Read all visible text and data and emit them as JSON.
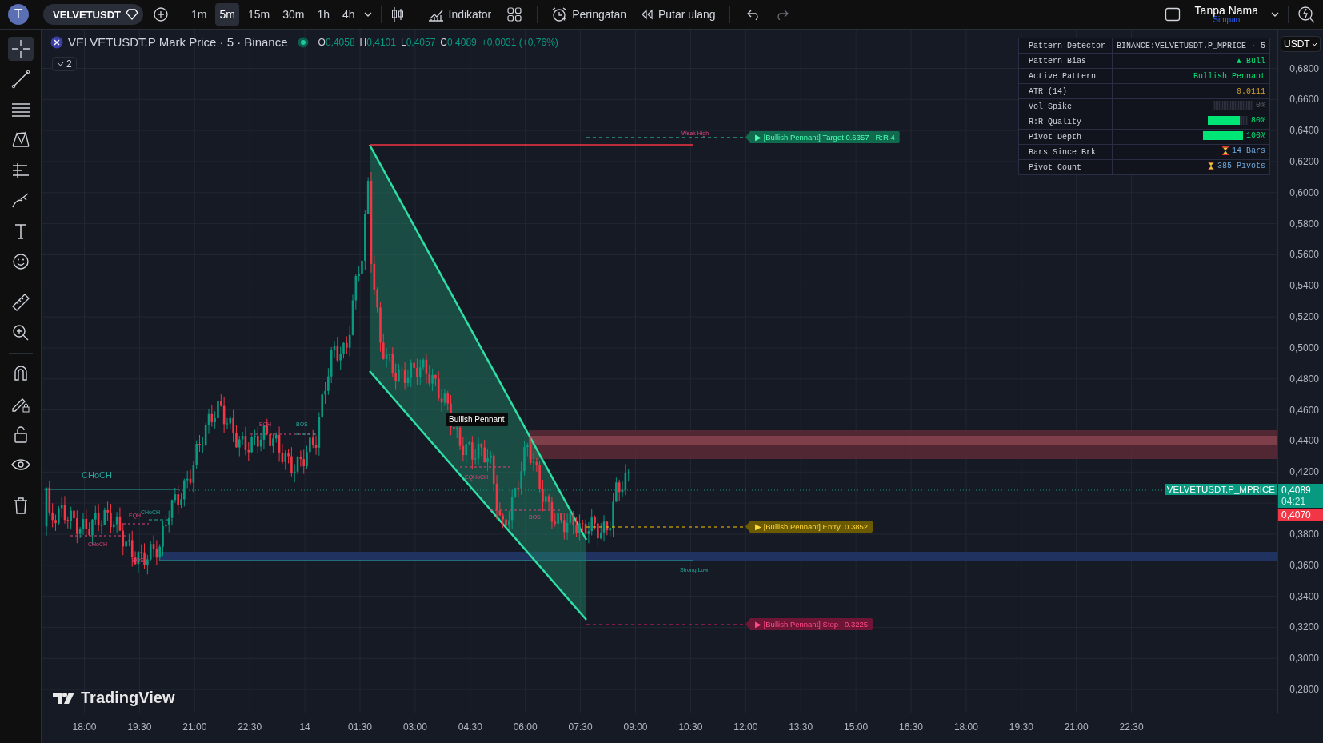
{
  "topbar": {
    "avatar": "T",
    "symbol": "VELVETUSDT",
    "intervals": [
      {
        "label": "1m",
        "selected": false
      },
      {
        "label": "5m",
        "selected": true
      },
      {
        "label": "15m",
        "selected": false
      },
      {
        "label": "30m",
        "selected": false
      },
      {
        "label": "1h",
        "selected": false
      },
      {
        "label": "4h",
        "selected": false
      }
    ],
    "actions": [
      {
        "kind": "indicators",
        "label": "Indikator"
      },
      {
        "kind": "alert",
        "label": "Peringatan"
      },
      {
        "kind": "replay",
        "label": "Putar ulang"
      }
    ],
    "layout_name": "Tanpa Nama",
    "save_status": "Simpan"
  },
  "tools": [
    {
      "kind": "crosshair",
      "selected": true
    },
    {
      "kind": "trend-line",
      "selected": false
    },
    {
      "kind": "fib",
      "selected": false
    },
    {
      "kind": "pattern",
      "selected": false
    },
    {
      "kind": "forecast",
      "selected": false
    },
    {
      "kind": "brush",
      "selected": false
    },
    {
      "kind": "text",
      "selected": false
    },
    {
      "kind": "emoji",
      "selected": false
    },
    {
      "kind": "ruler",
      "selected": false
    },
    {
      "kind": "zoom",
      "selected": false
    },
    {
      "kind": "magnet",
      "selected": false
    },
    {
      "kind": "lock-drawing",
      "selected": false
    },
    {
      "kind": "lock",
      "selected": false
    },
    {
      "kind": "eye",
      "selected": false
    },
    {
      "kind": "trash",
      "selected": false
    }
  ],
  "legend": {
    "title": "VELVETUSDT.P Mark Price · 5 · Binance",
    "ohlc": [
      {
        "key": "O",
        "value": "0,4058"
      },
      {
        "key": "H",
        "value": "0,4101"
      },
      {
        "key": "L",
        "value": "0,4057"
      },
      {
        "key": "C",
        "value": "0,4089"
      }
    ],
    "change": "+0,0031 (+0,76%)",
    "indicator_count": "2"
  },
  "table": {
    "header": [
      "Pattern Detector",
      "BINANCE:VELVETUSDT.P_MPRICE · 5"
    ],
    "rows": [
      {
        "label": "Pattern Bias",
        "kind": "text",
        "value": "▲ Bull",
        "color": "#00e676"
      },
      {
        "label": "Active Pattern",
        "kind": "text",
        "value": "Bullish Pennant",
        "color": "#00e676"
      },
      {
        "label": "ATR (14)",
        "kind": "text",
        "value": "0.0111",
        "color": "#d4a02c"
      },
      {
        "label": "Vol Spike",
        "kind": "bar",
        "level": 0,
        "value": "0%",
        "color": "#5d626d"
      },
      {
        "label": "R:R Quality",
        "kind": "bar",
        "level": 0.8,
        "value": "80%",
        "color": "#00e676"
      },
      {
        "label": "Pivot Depth",
        "kind": "bar",
        "level": 1,
        "value": "100%",
        "color": "#00e676"
      },
      {
        "label": "Bars Since Brk",
        "kind": "hourglass",
        "value": "14 Bars",
        "color": "#6fa8dc"
      },
      {
        "label": "Pivot Count",
        "kind": "hourglass",
        "value": "385 Pivots",
        "color": "#6fa8dc"
      }
    ]
  },
  "chart": {
    "structure_labels": [
      {
        "text": "CHoCH",
        "kind": "bull"
      },
      {
        "text": "EQH",
        "kind": "bear"
      },
      {
        "text": "BOS",
        "kind": "bull"
      },
      {
        "text": "EQH",
        "kind": "bear"
      },
      {
        "text": "CHoCH",
        "kind": "bull"
      },
      {
        "text": "CHoCH",
        "kind": "bear"
      },
      {
        "text": "BOS",
        "kind": "bear"
      },
      {
        "text": "EQHoCH",
        "kind": "bear"
      },
      {
        "text": "BOS",
        "kind": "bear"
      }
    ],
    "weak_high": "Weak High",
    "strong_low": "Strong Low",
    "pattern_label": "Bullish Pennant",
    "signals": [
      {
        "kind": "target",
        "text": "▶ [Bullish Pennant] Target 0.6357   R:R 4"
      },
      {
        "kind": "entry",
        "text": "▶ [Bullish Pennant] Entry  0.3852"
      },
      {
        "kind": "stop",
        "text": "▶ [Bullish Pennant] Stop   0.3225"
      }
    ]
  },
  "price_axis": {
    "currency": "USDT",
    "ticks": [
      "0,6800",
      "0,6600",
      "0,6400",
      "0,6200",
      "0,6000",
      "0,5800",
      "0,5600",
      "0,5400",
      "0,5200",
      "0,5000",
      "0,4800",
      "0,4600",
      "0,4400",
      "0,4200",
      "0,3800",
      "0,3600",
      "0,3400",
      "0,3200",
      "0,3000",
      "0,2800"
    ],
    "symbol_tag": "VELVETUSDT.P_MPRICE",
    "last_price": "0,4089",
    "countdown": "04:21",
    "prev_close": "0,4070"
  },
  "time_axis": [
    "18:00",
    "19:30",
    "21:00",
    "22:30",
    "14",
    "01:30",
    "03:00",
    "04:30",
    "06:00",
    "07:30",
    "09:00",
    "10:30",
    "12:00",
    "13:30",
    "15:00",
    "16:30",
    "18:00",
    "19:30",
    "21:00",
    "22:30"
  ],
  "logo": "TradingView"
}
